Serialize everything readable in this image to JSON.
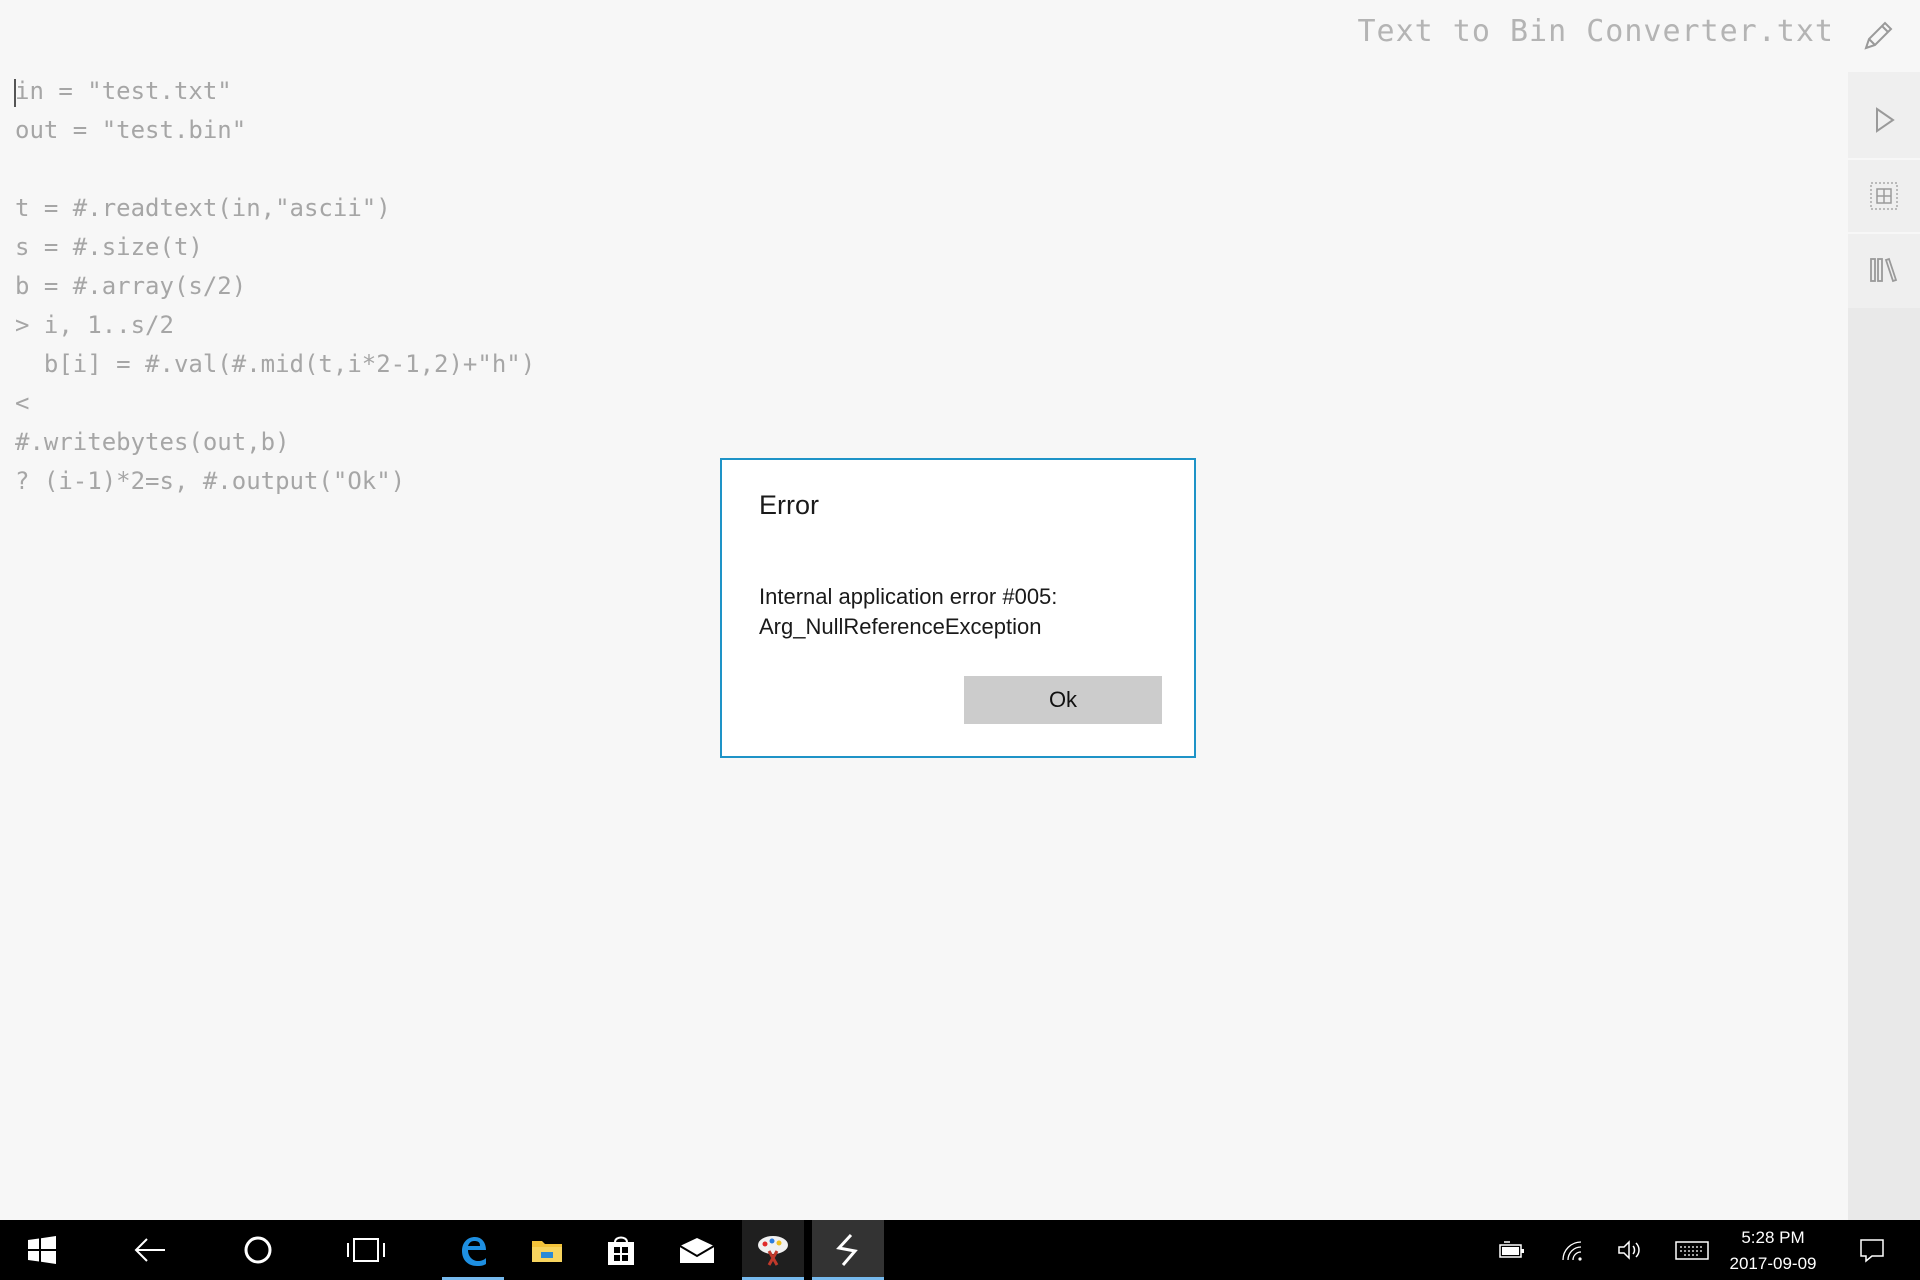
{
  "app": {
    "file_title": "Text to Bin Converter.txt"
  },
  "editor": {
    "lines": [
      "in = \"test.txt\"",
      "out = \"test.bin\"",
      "",
      "t = #.readtext(in,\"ascii\")",
      "s = #.size(t)",
      "b = #.array(s/2)",
      "> i, 1..s/2",
      "  b[i] = #.val(#.mid(t,i*2-1,2)+\"h\")",
      "<",
      "#.writebytes(out,b)",
      "? (i-1)*2=s, #.output(\"Ok\")"
    ]
  },
  "rail": {
    "icons": [
      "edit-icon",
      "play-icon",
      "grid-icon",
      "library-icon"
    ]
  },
  "dialog": {
    "title": "Error",
    "message_line1": "Internal application error #005:",
    "message_line2": "Arg_NullReferenceException",
    "ok_label": "Ok",
    "border_color": "#1e93c7"
  },
  "taskbar": {
    "icons": [
      "windows-start-icon",
      "back-arrow-icon",
      "cortana-circle-icon",
      "task-view-icon",
      "edge-icon",
      "file-explorer-icon",
      "store-icon",
      "mail-icon",
      "paint-icon",
      "app-icon"
    ],
    "tray_icons": [
      "battery-icon",
      "wifi-icon",
      "volume-icon",
      "keyboard-icon",
      "action-center-icon"
    ],
    "time": "5:28 PM",
    "date": "2017-09-09"
  }
}
